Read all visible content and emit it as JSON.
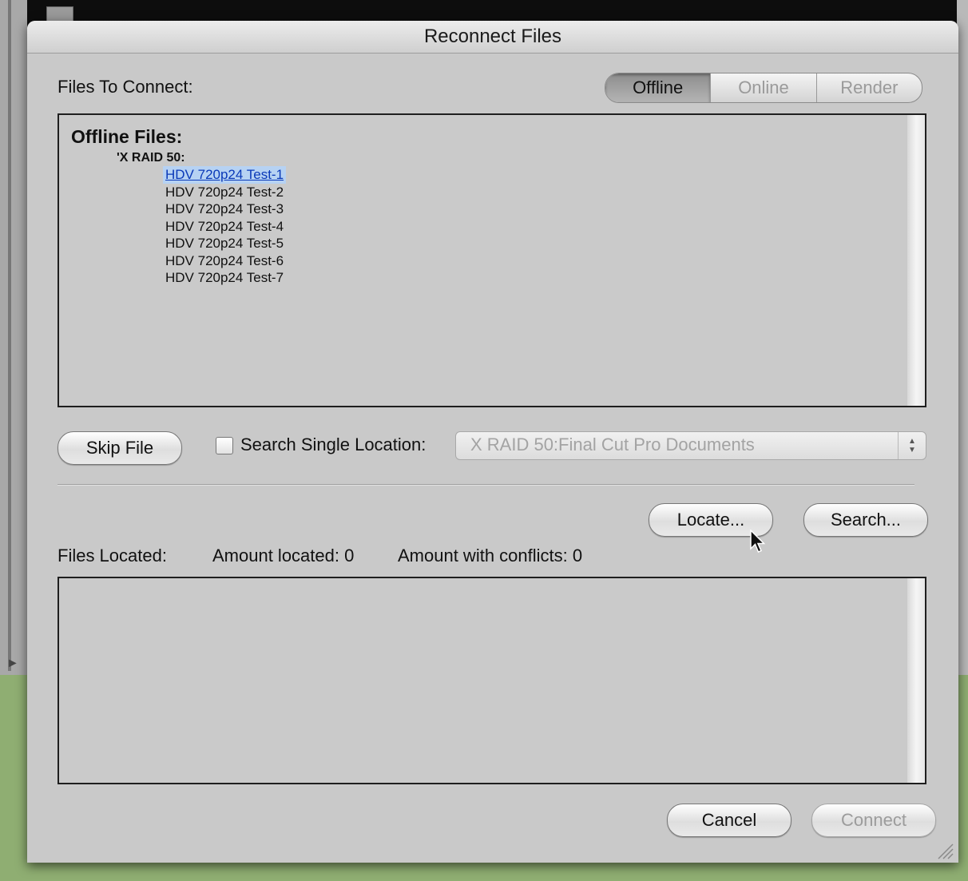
{
  "dialog": {
    "title": "Reconnect Files",
    "files_to_connect_label": "Files To Connect:",
    "tabs": [
      {
        "label": "Offline",
        "active": true
      },
      {
        "label": "Online",
        "active": false
      },
      {
        "label": "Render",
        "active": false
      }
    ],
    "offline_list": {
      "heading": "Offline Files:",
      "volume": "'X RAID 50:",
      "files": [
        "HDV 720p24 Test-1",
        "HDV 720p24 Test-2",
        "HDV 720p24 Test-3",
        "HDV 720p24 Test-4",
        "HDV 720p24 Test-5",
        "HDV 720p24 Test-6",
        "HDV 720p24 Test-7"
      ],
      "selected_index": 0
    },
    "skip_file_label": "Skip File",
    "search_single_location": {
      "label": "Search Single Location:",
      "checked": false,
      "value": "X RAID 50:Final Cut Pro Documents"
    },
    "locate_label": "Locate...",
    "search_label": "Search...",
    "files_located_label": "Files Located:",
    "amount_located": "Amount located: 0",
    "amount_conflicts": "Amount with conflicts: 0",
    "cancel_label": "Cancel",
    "connect_label": "Connect"
  },
  "icons": {
    "cursor": "arrow-cursor-icon",
    "resize": "resize-grip-icon",
    "popup_arrows": "up-down-arrows-icon"
  },
  "colors": {
    "dialog_bg": "#c9c9c9",
    "selection_bg": "#b6d2f3",
    "selection_text": "#0a39b8",
    "disabled_text": "#9c9c9c"
  }
}
